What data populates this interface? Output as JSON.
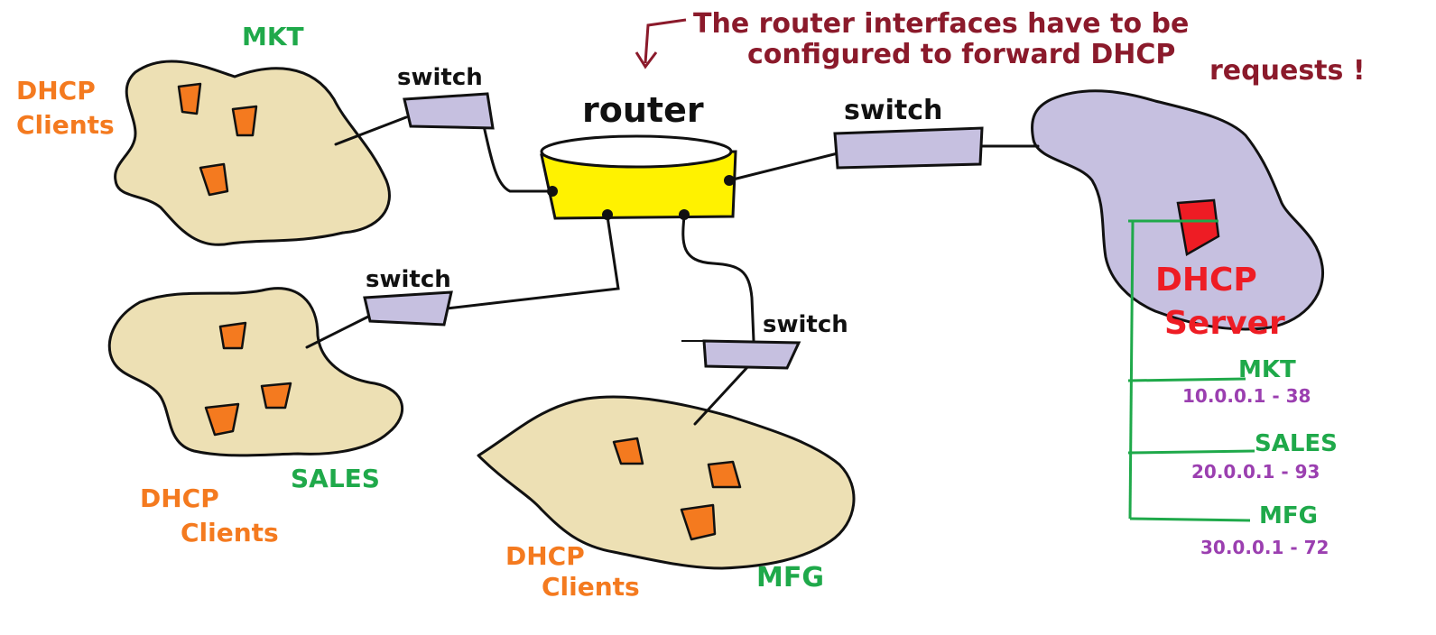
{
  "annotation": {
    "line1": "The router interfaces have to be",
    "line2": "configured to forward DHCP",
    "line3": "requests !"
  },
  "router": {
    "label": "router"
  },
  "switches": [
    {
      "id": "mkt",
      "label": "switch"
    },
    {
      "id": "sales",
      "label": "switch"
    },
    {
      "id": "mfg",
      "label": "switch"
    },
    {
      "id": "server",
      "label": "switch"
    }
  ],
  "clouds": {
    "mkt": {
      "name": "MKT",
      "clients_line1": "DHCP",
      "clients_line2": "Clients"
    },
    "sales": {
      "name": "SALES",
      "clients_line1": "DHCP",
      "clients_line2": "Clients"
    },
    "mfg": {
      "name": "MFG",
      "clients_line1": "DHCP",
      "clients_line2": "Clients"
    }
  },
  "server": {
    "line1": "DHCP",
    "line2": "Server",
    "scopes": [
      {
        "name": "MKT",
        "range": "10.0.0.1 - 38"
      },
      {
        "name": "SALES",
        "range": "20.0.0.1 - 93"
      },
      {
        "name": "MFG",
        "range": "30.0.0.1 - 72"
      }
    ]
  },
  "colors": {
    "client_cloud": "#ede0b4",
    "server_cloud": "#c6c0e0",
    "switch_fill": "#c6c0e0",
    "router_fill": "#fff200",
    "client_icon": "#f47a1f",
    "server_icon": "#ee1c24",
    "annotation": "#8b1a2b",
    "orange_text": "#f47a1f",
    "green_text": "#1fa94a",
    "red_text": "#ee1c24",
    "purple_text": "#9b3fb0",
    "stroke": "#111111"
  }
}
